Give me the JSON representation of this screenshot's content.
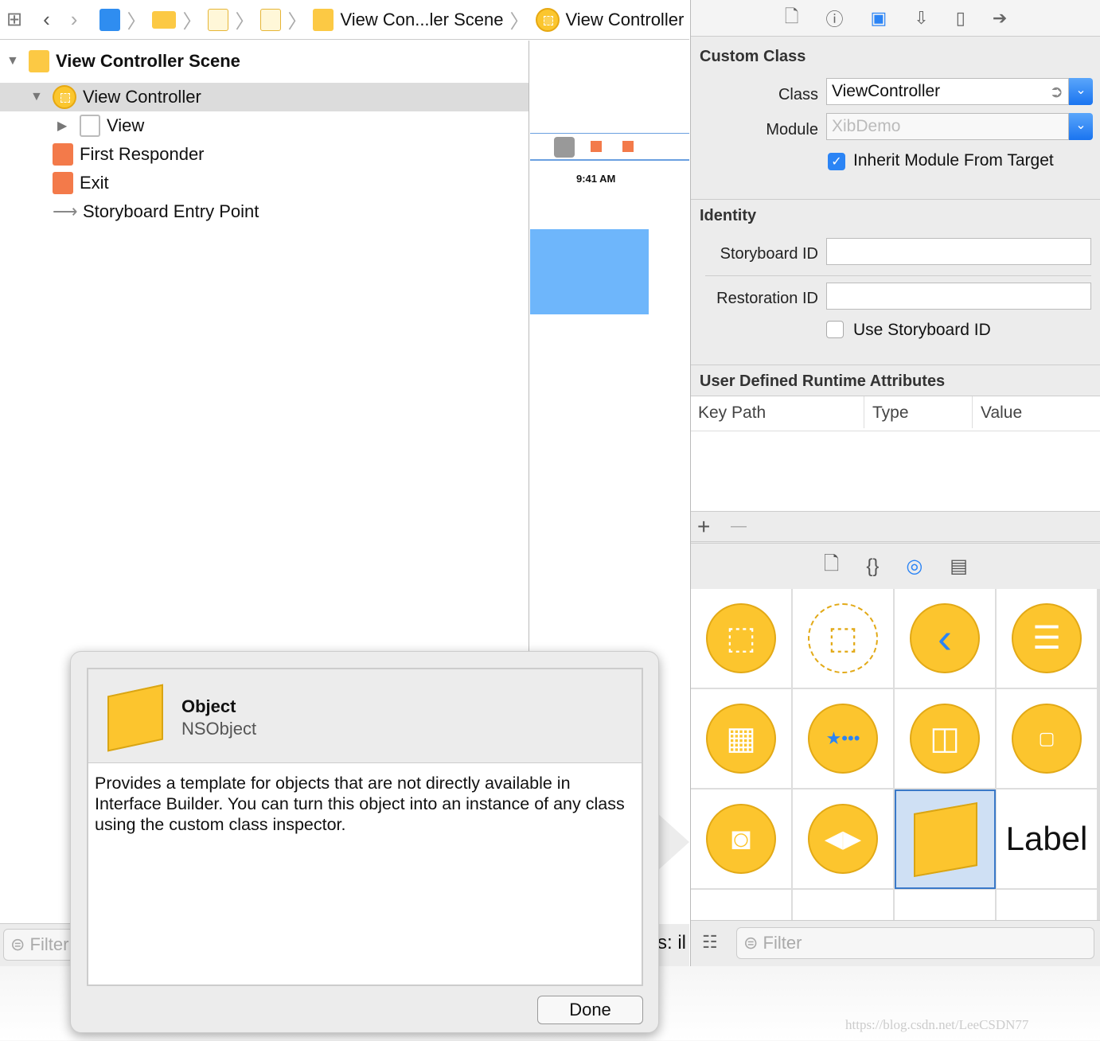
{
  "jumpbar": {
    "items": [
      "View Con...ler Scene",
      "View Controller"
    ]
  },
  "navigator": {
    "scene": "View Controller Scene",
    "items": [
      "View Controller",
      "View",
      "First Responder",
      "Exit",
      "Storyboard Entry Point"
    ],
    "filter_placeholder": "Filter"
  },
  "canvas": {
    "time": "9:41 AM",
    "partial_text": "s: il"
  },
  "inspector": {
    "custom_class": {
      "title": "Custom Class",
      "class_label": "Class",
      "class_value": "ViewController",
      "module_label": "Module",
      "module_placeholder": "XibDemo",
      "inherit_label": "Inherit Module From Target",
      "inherit_checked": true
    },
    "identity": {
      "title": "Identity",
      "storyboard_id_label": "Storyboard ID",
      "restoration_id_label": "Restoration ID",
      "use_storyboard_label": "Use Storyboard ID",
      "use_storyboard_checked": false
    },
    "runtime": {
      "title": "User Defined Runtime Attributes",
      "columns": [
        "Key Path",
        "Type",
        "Value"
      ],
      "add": "+",
      "remove": "—"
    }
  },
  "library": {
    "label_item": "Label",
    "filter_placeholder": "Filter"
  },
  "popover": {
    "title": "Object",
    "subtitle": "NSObject",
    "description": "Provides a template for objects that are not directly available in Interface Builder. You can turn this object into an instance of any class using the custom class inspector.",
    "done": "Done"
  },
  "watermark": "https://blog.csdn.net/LeeCSDN77",
  "colors": {
    "accent": "#2b84f5",
    "library_yellow": "#fcc52e",
    "selection": "#dcdcdc",
    "canvas_blue": "#6eb6fb"
  }
}
